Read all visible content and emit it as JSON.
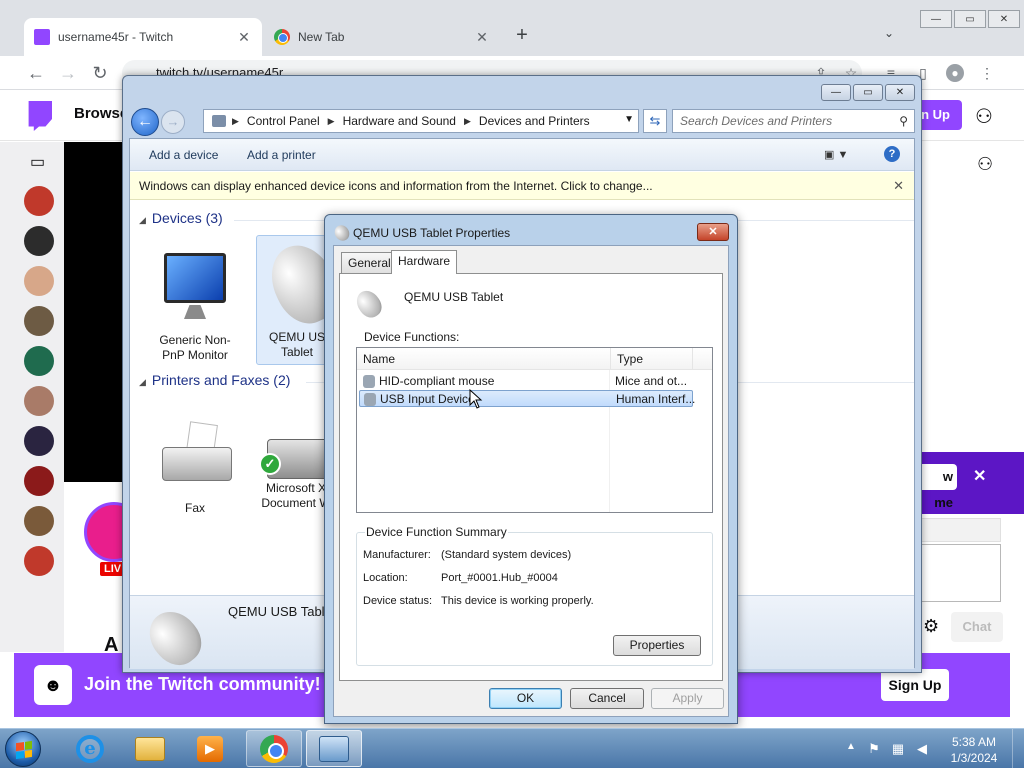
{
  "chrome": {
    "tabs": [
      {
        "title": "username45r - Twitch",
        "favicon": "twitch-icon"
      },
      {
        "title": "New Tab",
        "favicon": "chrome-icon"
      }
    ],
    "new_tab": "+",
    "tab_menu": "⌄",
    "url": "twitch.tv/username45r",
    "win_min": "—",
    "win_max": "▭",
    "win_close": "✕"
  },
  "twitch": {
    "browse": "Browse",
    "signup_top": "n Up",
    "live": "LIV",
    "channel_initial": "A",
    "follow_btn": "w me",
    "chat_btn": "Chat",
    "join_text": "Join the Twitch community!",
    "join_signup": "Sign Up"
  },
  "control_panel": {
    "breadcrumb": [
      "Control Panel",
      "Hardware and Sound",
      "Devices and Printers"
    ],
    "search_placeholder": "Search Devices and Printers",
    "commands": {
      "add_device": "Add a device",
      "add_printer": "Add a printer"
    },
    "infobar": "Windows can display enhanced device icons and information from the Internet. Click to change...",
    "groups": {
      "devices": "Devices (3)",
      "printers": "Printers and Faxes (2)"
    },
    "devices": [
      {
        "label": "Generic Non-PnP Monitor"
      },
      {
        "label": "QEMU US Tablet"
      }
    ],
    "printers": [
      {
        "label": "Fax"
      },
      {
        "label": "Microsoft X Document W"
      }
    ],
    "details_name": "QEMU USB Tablet"
  },
  "dialog": {
    "title": "QEMU USB Tablet Properties",
    "tabs": [
      "General",
      "Hardware"
    ],
    "device_name": "QEMU USB Tablet",
    "functions_label": "Device Functions:",
    "columns": {
      "name": "Name",
      "type": "Type"
    },
    "rows": [
      {
        "name": "HID-compliant mouse",
        "type": "Mice and ot..."
      },
      {
        "name": "USB Input Device",
        "type": "Human Interf..."
      }
    ],
    "summary_title": "Device Function Summary",
    "summary": {
      "manufacturer_k": "Manufacturer:",
      "manufacturer_v": "(Standard system devices)",
      "location_k": "Location:",
      "location_v": "Port_#0001.Hub_#0004",
      "status_k": "Device status:",
      "status_v": "This device is working properly."
    },
    "properties_btn": "Properties",
    "ok": "OK",
    "cancel": "Cancel",
    "apply": "Apply"
  },
  "taskbar": {
    "time": "5:38 AM",
    "date": "1/3/2024"
  }
}
